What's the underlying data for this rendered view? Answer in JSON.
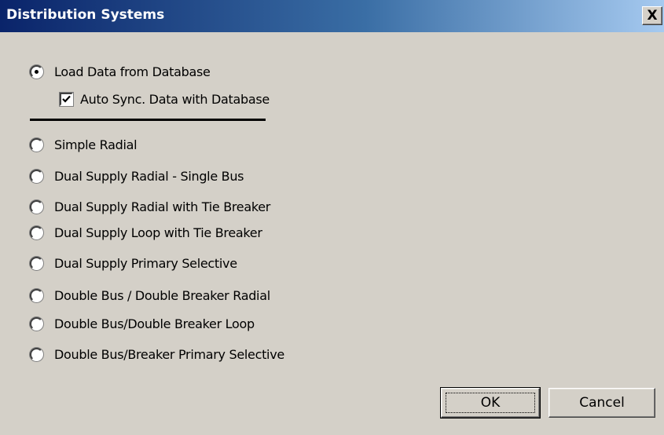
{
  "window": {
    "title": "Distribution Systems",
    "close_label": "X"
  },
  "options": {
    "load_from_database": {
      "label": "Load Data from Database",
      "selected": true
    },
    "auto_sync": {
      "label": "Auto Sync. Data with Database",
      "checked": true
    },
    "systems": [
      {
        "label": "Simple Radial",
        "selected": false
      },
      {
        "label": "Dual Supply Radial - Single Bus",
        "selected": false
      },
      {
        "label": "Dual Supply Radial with Tie Breaker",
        "selected": false
      },
      {
        "label": "Dual Supply Loop with Tie Breaker",
        "selected": false
      },
      {
        "label": "Dual Supply Primary Selective",
        "selected": false
      },
      {
        "label": "Double Bus / Double Breaker Radial",
        "selected": false
      },
      {
        "label": "Double Bus/Double Breaker Loop",
        "selected": false
      },
      {
        "label": "Double Bus/Breaker Primary Selective",
        "selected": false
      }
    ]
  },
  "buttons": {
    "ok_label": "OK",
    "cancel_label": "Cancel"
  }
}
